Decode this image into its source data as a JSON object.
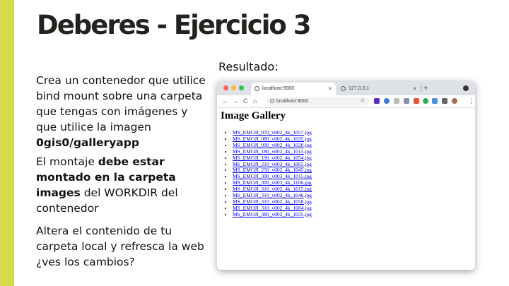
{
  "slide": {
    "title": "Deberes - Ejercicio 3",
    "accent_color": "#d7da4a",
    "paragraph1": {
      "text": "Crea un contenedor que utilice bind mount sobre una carpeta que tengas con imágenes y que utilice la imagen ",
      "bold": "0gis0/galleryapp"
    },
    "paragraph2": {
      "text1": "El montaje ",
      "bold1": "debe estar montado en la carpeta images",
      "text2": " del WORKDIR del contenedor"
    },
    "paragraph3": "Altera el contenido de tu carpeta local y refresca la web ¿ves los cambios?",
    "result_label": "Resultado:"
  },
  "browser": {
    "tabs": [
      {
        "label": "localhost:9000",
        "active": true,
        "close": "×"
      },
      {
        "label": "127.0.0.1",
        "active": false,
        "close": "×"
      }
    ],
    "new_tab": "+",
    "nav": {
      "back": "←",
      "forward": "→",
      "reload": "C",
      "home": "⌂"
    },
    "url": "localhost:9000",
    "star": "☆",
    "menu": "⋮",
    "page": {
      "heading": "Image Gallery",
      "files": [
        "MS_EMOJI_070_v002_4k_1057.jpg",
        "MS_EMOJI_080_v002_4k_1035.jpg",
        "MS_EMOJI_090_v002_4k_1020.jpg",
        "MS_EMOJI_180_v002_4k_1015.jpg",
        "MS_EMOJI_190_v002_4k_1054.jpg",
        "MS_EMOJI_210_v002_4k_1065.jpg",
        "MS_EMOJI_250_v002_4k_1045.jpg",
        "MS_EMOJI_300_v003_4k_1015.jpg",
        "MS_EMOJI_300_v003_4k_1106.jpg",
        "MS_EMOJI_310_v002_4k_1015.jpg",
        "MS_EMOJI_310_v002_4k_1046.jpg",
        "MS_EMOJI_310_v002_4k_1058.jpg",
        "MS_EMOJI_310_v002_4k_1084.jpg",
        "MS_EMOJI_380_v002_4k_1035.jpg"
      ]
    }
  }
}
